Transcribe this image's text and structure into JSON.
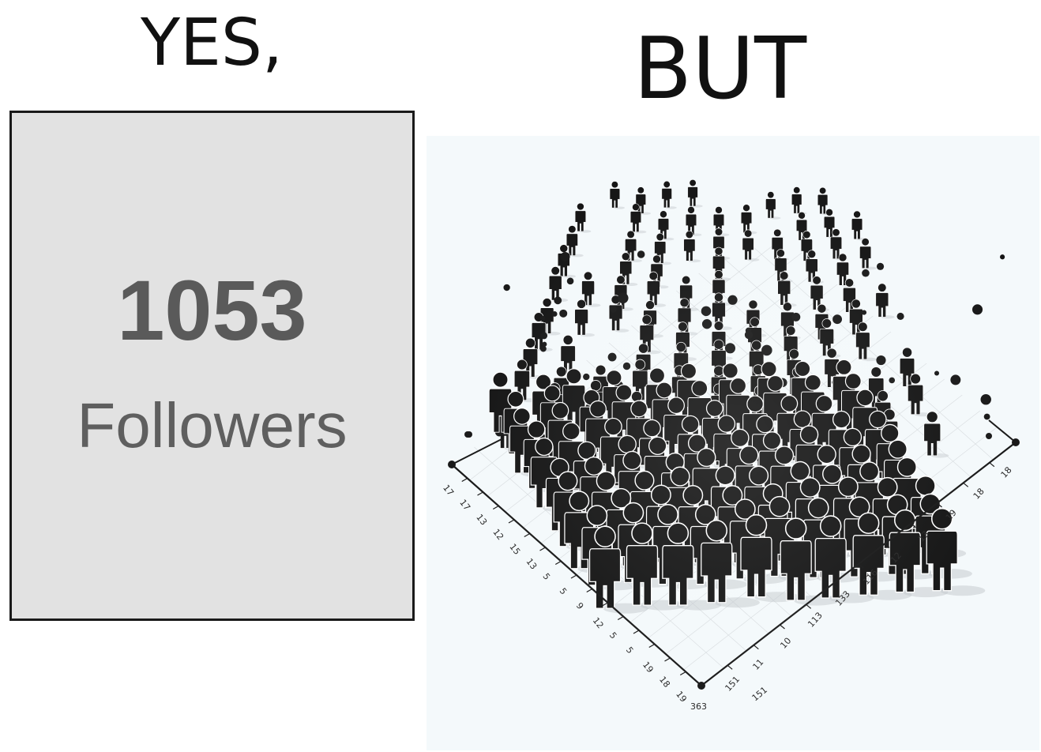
{
  "left_panel": {
    "heading": "YES,",
    "card": {
      "count": "1053",
      "label": "Followers",
      "background_color": "#e2e2e2",
      "text_color": "#5a5a5a"
    }
  },
  "right_panel": {
    "heading": "BUT",
    "illustration": "crowd-of-human-figures-on-chart-grid",
    "left_axis_ticks": [
      "17",
      "17",
      "13",
      "12",
      "15",
      "13",
      "5",
      "5",
      "9",
      "12",
      "5",
      "5",
      "19",
      "18",
      "19"
    ],
    "right_axis_ticks": [
      "151",
      "11",
      "10",
      "113",
      "133",
      "116",
      "12",
      "13",
      "19",
      "18",
      "18"
    ],
    "corner_labels": [
      "363",
      "151"
    ]
  }
}
